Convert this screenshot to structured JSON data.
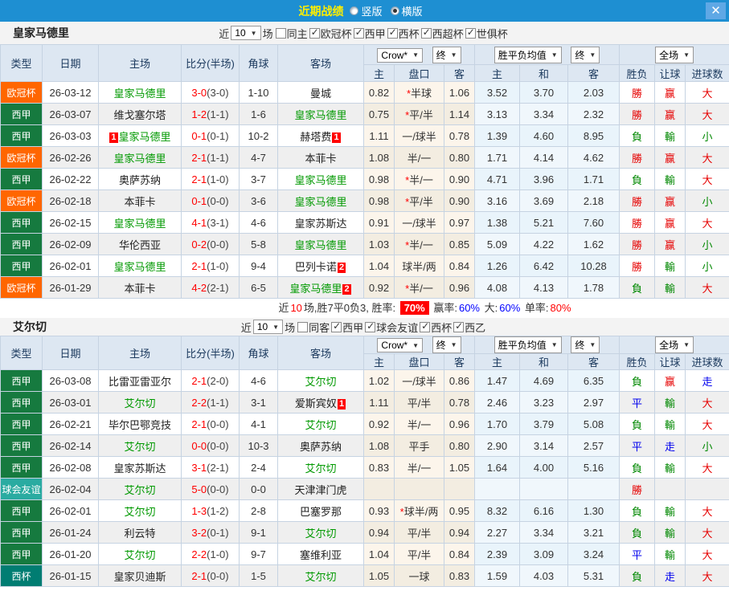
{
  "titlebar": {
    "title": "近期战绩",
    "vertical": "竖版",
    "horizontal": "横版",
    "close": "✕"
  },
  "table_headers": {
    "type": "类型",
    "date": "日期",
    "home": "主场",
    "score": "比分(半场)",
    "corner": "角球",
    "away": "客场",
    "dd_crow": "Crow*",
    "dd_end1": "终",
    "dd_avg": "胜平负均值",
    "dd_end2": "终",
    "dd_full": "全场",
    "sub": [
      "主",
      "盘口",
      "客",
      "主",
      "和",
      "客",
      "胜负",
      "让球",
      "进球数"
    ]
  },
  "type_colors": {
    "欧冠杯": "#ff6600",
    "西甲": "#167a3f",
    "球会友谊": "#2aaba1",
    "西杯": "#007d72"
  },
  "result_colors": {
    "勝": "#e60000",
    "赢": "#e60000",
    "大": "#e60000",
    "負": "#008800",
    "輸": "#008800",
    "小": "#008800",
    "平": "#0000ee",
    "走": "#0000ee"
  },
  "sections": [
    {
      "team": "皇家马德里",
      "filter": {
        "near": "近",
        "count": "10",
        "games": "场",
        "same": "同主",
        "leagues": [
          "欧冠杯",
          "西甲",
          "西杯",
          "西超杯",
          "世俱杯"
        ]
      },
      "rows": [
        {
          "type": "欧冠杯",
          "date": "26-03-12",
          "home": {
            "name": "皇家马德里",
            "focus": true
          },
          "score": "3-0",
          "half": "(3-0)",
          "corner": "1-10",
          "away": {
            "name": "曼城",
            "focus": false
          },
          "odds": [
            "0.82",
            "*半球",
            "1.06"
          ],
          "avg": [
            "3.52",
            "3.70",
            "2.03"
          ],
          "results": [
            "勝",
            "赢",
            "大"
          ]
        },
        {
          "type": "西甲",
          "date": "26-03-07",
          "home": {
            "name": "维戈塞尔塔",
            "focus": false
          },
          "score": "1-2",
          "half": "(1-1)",
          "corner": "1-6",
          "away": {
            "name": "皇家马德里",
            "focus": true
          },
          "odds": [
            "0.75",
            "*平/半",
            "1.14"
          ],
          "avg": [
            "3.13",
            "3.34",
            "2.32"
          ],
          "results": [
            "勝",
            "赢",
            "大"
          ]
        },
        {
          "type": "西甲",
          "date": "26-03-03",
          "home": {
            "name": "皇家马德里",
            "focus": true,
            "badge": "1",
            "badge_pos": "before"
          },
          "score": "0-1",
          "half": "(0-1)",
          "corner": "10-2",
          "away": {
            "name": "赫塔费",
            "focus": false,
            "badge": "1",
            "badge_pos": "after"
          },
          "odds": [
            "1.11",
            "一/球半",
            "0.78"
          ],
          "avg": [
            "1.39",
            "4.60",
            "8.95"
          ],
          "results": [
            "負",
            "輸",
            "小"
          ]
        },
        {
          "type": "欧冠杯",
          "date": "26-02-26",
          "home": {
            "name": "皇家马德里",
            "focus": true
          },
          "score": "2-1",
          "half": "(1-1)",
          "corner": "4-7",
          "away": {
            "name": "本菲卡",
            "focus": false
          },
          "odds": [
            "1.08",
            "半/一",
            "0.80"
          ],
          "avg": [
            "1.71",
            "4.14",
            "4.62"
          ],
          "results": [
            "勝",
            "赢",
            "大"
          ]
        },
        {
          "type": "西甲",
          "date": "26-02-22",
          "home": {
            "name": "奥萨苏纳",
            "focus": false
          },
          "score": "2-1",
          "half": "(1-0)",
          "corner": "3-7",
          "away": {
            "name": "皇家马德里",
            "focus": true
          },
          "odds": [
            "0.98",
            "*半/一",
            "0.90"
          ],
          "avg": [
            "4.71",
            "3.96",
            "1.71"
          ],
          "results": [
            "負",
            "輸",
            "大"
          ]
        },
        {
          "type": "欧冠杯",
          "date": "26-02-18",
          "home": {
            "name": "本菲卡",
            "focus": false
          },
          "score": "0-1",
          "half": "(0-0)",
          "corner": "3-6",
          "away": {
            "name": "皇家马德里",
            "focus": true
          },
          "odds": [
            "0.98",
            "*平/半",
            "0.90"
          ],
          "avg": [
            "3.16",
            "3.69",
            "2.18"
          ],
          "results": [
            "勝",
            "赢",
            "小"
          ]
        },
        {
          "type": "西甲",
          "date": "26-02-15",
          "home": {
            "name": "皇家马德里",
            "focus": true
          },
          "score": "4-1",
          "half": "(3-1)",
          "corner": "4-6",
          "away": {
            "name": "皇家苏斯达",
            "focus": false
          },
          "odds": [
            "0.91",
            "一/球半",
            "0.97"
          ],
          "avg": [
            "1.38",
            "5.21",
            "7.60"
          ],
          "results": [
            "勝",
            "赢",
            "大"
          ]
        },
        {
          "type": "西甲",
          "date": "26-02-09",
          "home": {
            "name": "华伦西亚",
            "focus": false
          },
          "score": "0-2",
          "half": "(0-0)",
          "corner": "5-8",
          "away": {
            "name": "皇家马德里",
            "focus": true
          },
          "odds": [
            "1.03",
            "*半/一",
            "0.85"
          ],
          "avg": [
            "5.09",
            "4.22",
            "1.62"
          ],
          "results": [
            "勝",
            "赢",
            "小"
          ]
        },
        {
          "type": "西甲",
          "date": "26-02-01",
          "home": {
            "name": "皇家马德里",
            "focus": true
          },
          "score": "2-1",
          "half": "(1-0)",
          "corner": "9-4",
          "away": {
            "name": "巴列卡诺",
            "focus": false,
            "badge": "2",
            "badge_pos": "after"
          },
          "odds": [
            "1.04",
            "球半/两",
            "0.84"
          ],
          "avg": [
            "1.26",
            "6.42",
            "10.28"
          ],
          "results": [
            "勝",
            "輸",
            "小"
          ]
        },
        {
          "type": "欧冠杯",
          "date": "26-01-29",
          "home": {
            "name": "本菲卡",
            "focus": false
          },
          "score": "4-2",
          "half": "(2-1)",
          "corner": "6-5",
          "away": {
            "name": "皇家马德里",
            "focus": true,
            "badge": "2",
            "badge_pos": "after"
          },
          "odds": [
            "0.92",
            "*半/一",
            "0.96"
          ],
          "avg": [
            "4.08",
            "4.13",
            "1.78"
          ],
          "results": [
            "負",
            "輸",
            "大"
          ]
        }
      ],
      "summary": {
        "near": "近",
        "count": "10",
        "record": "场,胜7平0负3, 胜率:",
        "win_rate": "70%",
        "win_label": "赢率:",
        "win_value": "60%",
        "big_label": "大:",
        "big_value": "60%",
        "single_label": "单率:",
        "single_value": "80%"
      }
    },
    {
      "team": "艾尔切",
      "filter": {
        "near": "近",
        "count": "10",
        "games": "场",
        "same": "同客",
        "leagues": [
          "西甲",
          "球会友谊",
          "西杯",
          "西乙"
        ]
      },
      "rows": [
        {
          "type": "西甲",
          "date": "26-03-08",
          "home": {
            "name": "比雷亚雷亚尔",
            "focus": false
          },
          "score": "2-1",
          "half": "(2-0)",
          "corner": "4-6",
          "away": {
            "name": "艾尔切",
            "focus": true
          },
          "odds": [
            "1.02",
            "一/球半",
            "0.86"
          ],
          "avg": [
            "1.47",
            "4.69",
            "6.35"
          ],
          "results": [
            "負",
            "赢",
            "走"
          ]
        },
        {
          "type": "西甲",
          "date": "26-03-01",
          "home": {
            "name": "艾尔切",
            "focus": true
          },
          "score": "2-2",
          "half": "(1-1)",
          "corner": "3-1",
          "away": {
            "name": "爱斯宾奴",
            "focus": false,
            "badge": "1",
            "badge_pos": "after"
          },
          "odds": [
            "1.11",
            "平/半",
            "0.78"
          ],
          "avg": [
            "2.46",
            "3.23",
            "2.97"
          ],
          "results": [
            "平",
            "輸",
            "大"
          ]
        },
        {
          "type": "西甲",
          "date": "26-02-21",
          "home": {
            "name": "毕尔巴鄂竞技",
            "focus": false
          },
          "score": "2-1",
          "half": "(0-0)",
          "corner": "4-1",
          "away": {
            "name": "艾尔切",
            "focus": true
          },
          "odds": [
            "0.92",
            "半/一",
            "0.96"
          ],
          "avg": [
            "1.70",
            "3.79",
            "5.08"
          ],
          "results": [
            "負",
            "輸",
            "大"
          ]
        },
        {
          "type": "西甲",
          "date": "26-02-14",
          "home": {
            "name": "艾尔切",
            "focus": true
          },
          "score": "0-0",
          "half": "(0-0)",
          "corner": "10-3",
          "away": {
            "name": "奥萨苏纳",
            "focus": false
          },
          "odds": [
            "1.08",
            "平手",
            "0.80"
          ],
          "avg": [
            "2.90",
            "3.14",
            "2.57"
          ],
          "results": [
            "平",
            "走",
            "小"
          ]
        },
        {
          "type": "西甲",
          "date": "26-02-08",
          "home": {
            "name": "皇家苏斯达",
            "focus": false
          },
          "score": "3-1",
          "half": "(2-1)",
          "corner": "2-4",
          "away": {
            "name": "艾尔切",
            "focus": true
          },
          "odds": [
            "0.83",
            "半/一",
            "1.05"
          ],
          "avg": [
            "1.64",
            "4.00",
            "5.16"
          ],
          "results": [
            "負",
            "輸",
            "大"
          ]
        },
        {
          "type": "球会友谊",
          "date": "26-02-04",
          "home": {
            "name": "艾尔切",
            "focus": true
          },
          "score": "5-0",
          "half": "(0-0)",
          "corner": "0-0",
          "away": {
            "name": "天津津门虎",
            "focus": false
          },
          "odds": [
            "",
            "",
            ""
          ],
          "avg": [
            "",
            "",
            ""
          ],
          "results": [
            "勝",
            "",
            ""
          ]
        },
        {
          "type": "西甲",
          "date": "26-02-01",
          "home": {
            "name": "艾尔切",
            "focus": true
          },
          "score": "1-3",
          "half": "(1-2)",
          "corner": "2-8",
          "away": {
            "name": "巴塞罗那",
            "focus": false
          },
          "odds": [
            "0.93",
            "*球半/两",
            "0.95"
          ],
          "avg": [
            "8.32",
            "6.16",
            "1.30"
          ],
          "results": [
            "負",
            "輸",
            "大"
          ]
        },
        {
          "type": "西甲",
          "date": "26-01-24",
          "home": {
            "name": "利云特",
            "focus": false
          },
          "score": "3-2",
          "half": "(0-1)",
          "corner": "9-1",
          "away": {
            "name": "艾尔切",
            "focus": true
          },
          "odds": [
            "0.94",
            "平/半",
            "0.94"
          ],
          "avg": [
            "2.27",
            "3.34",
            "3.21"
          ],
          "results": [
            "負",
            "輸",
            "大"
          ]
        },
        {
          "type": "西甲",
          "date": "26-01-20",
          "home": {
            "name": "艾尔切",
            "focus": true
          },
          "score": "2-2",
          "half": "(1-0)",
          "corner": "9-7",
          "away": {
            "name": "塞维利亚",
            "focus": false
          },
          "odds": [
            "1.04",
            "平/半",
            "0.84"
          ],
          "avg": [
            "2.39",
            "3.09",
            "3.24"
          ],
          "results": [
            "平",
            "輸",
            "大"
          ]
        },
        {
          "type": "西杯",
          "date": "26-01-15",
          "home": {
            "name": "皇家贝迪斯",
            "focus": false
          },
          "score": "2-1",
          "half": "(0-0)",
          "corner": "1-5",
          "away": {
            "name": "艾尔切",
            "focus": true
          },
          "odds": [
            "1.05",
            "一球",
            "0.83"
          ],
          "avg": [
            "1.59",
            "4.03",
            "5.31"
          ],
          "results": [
            "負",
            "走",
            "大"
          ]
        }
      ],
      "summary": null
    }
  ]
}
